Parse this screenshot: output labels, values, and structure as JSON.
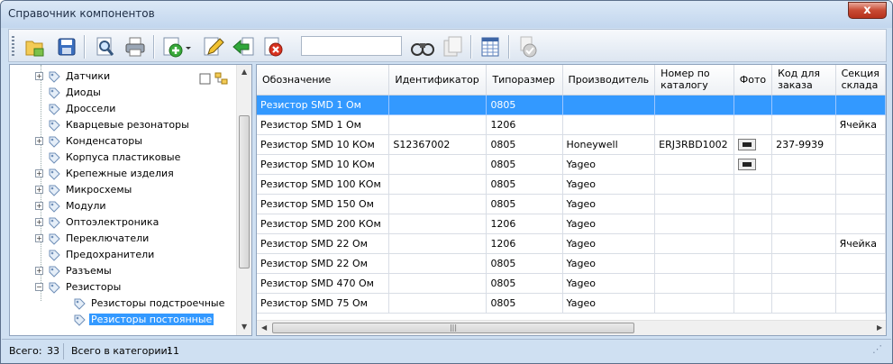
{
  "window": {
    "title": "Справочник компонентов",
    "close_label": "x"
  },
  "toolbar": {
    "buttons": [
      "open-folder",
      "save",
      "preview",
      "print",
      "add",
      "edit",
      "import",
      "delete",
      "find",
      "copy",
      "table",
      "approve"
    ],
    "search_value": ""
  },
  "tree": {
    "items": [
      {
        "label": "Датчики",
        "expander": "+"
      },
      {
        "label": "Диоды",
        "expander": ""
      },
      {
        "label": "Дроссели",
        "expander": ""
      },
      {
        "label": "Кварцевые резонаторы",
        "expander": ""
      },
      {
        "label": "Конденсаторы",
        "expander": "+"
      },
      {
        "label": "Корпуса пластиковые",
        "expander": ""
      },
      {
        "label": "Крепежные изделия",
        "expander": "+"
      },
      {
        "label": "Микросхемы",
        "expander": "+"
      },
      {
        "label": "Модули",
        "expander": "+"
      },
      {
        "label": "Оптоэлектроника",
        "expander": "+"
      },
      {
        "label": "Переключатели",
        "expander": "+"
      },
      {
        "label": "Предохранители",
        "expander": ""
      },
      {
        "label": "Разъемы",
        "expander": "+"
      },
      {
        "label": "Резисторы",
        "expander": "−"
      },
      {
        "label": "Резисторы подстроечные",
        "expander": ""
      },
      {
        "label": "Резисторы постоянные",
        "expander": ""
      }
    ],
    "selected_index": 15
  },
  "grid": {
    "columns": [
      "Обозначение",
      "Идентификатор",
      "Типоразмер",
      "Производитель",
      "Номер по каталогу",
      "Фото",
      "Код для заказа",
      "Секция склада"
    ],
    "rows": [
      {
        "name": "Резистор SMD 1 Ом",
        "id": "",
        "size": "0805",
        "maker": "",
        "catalog": "",
        "photo": false,
        "order": "",
        "section": ""
      },
      {
        "name": "Резистор SMD 1 Ом",
        "id": "",
        "size": "1206",
        "maker": "",
        "catalog": "",
        "photo": false,
        "order": "",
        "section": "Ячейка"
      },
      {
        "name": "Резистор SMD 10 КОм",
        "id": "S12367002",
        "size": "0805",
        "maker": "Honeywell",
        "catalog": "ERJ3RBD1002",
        "photo": true,
        "order": "237-9939",
        "section": ""
      },
      {
        "name": "Резистор SMD 10 КОм",
        "id": "",
        "size": "0805",
        "maker": "Yageo",
        "catalog": "",
        "photo": true,
        "order": "",
        "section": ""
      },
      {
        "name": "Резистор SMD 100 КОм",
        "id": "",
        "size": "0805",
        "maker": "Yageo",
        "catalog": "",
        "photo": false,
        "order": "",
        "section": ""
      },
      {
        "name": "Резистор SMD 150 Ом",
        "id": "",
        "size": "0805",
        "maker": "Yageo",
        "catalog": "",
        "photo": false,
        "order": "",
        "section": ""
      },
      {
        "name": "Резистор SMD 200 КОм",
        "id": "",
        "size": "1206",
        "maker": "Yageo",
        "catalog": "",
        "photo": false,
        "order": "",
        "section": ""
      },
      {
        "name": "Резистор SMD 22 Ом",
        "id": "",
        "size": "1206",
        "maker": "Yageo",
        "catalog": "",
        "photo": false,
        "order": "",
        "section": "Ячейка"
      },
      {
        "name": "Резистор SMD 22 Ом",
        "id": "",
        "size": "0805",
        "maker": "Yageo",
        "catalog": "",
        "photo": false,
        "order": "",
        "section": ""
      },
      {
        "name": "Резистор SMD 470 Ом",
        "id": "",
        "size": "0805",
        "maker": "Yageo",
        "catalog": "",
        "photo": false,
        "order": "",
        "section": ""
      },
      {
        "name": "Резистор SMD 75 Ом",
        "id": "",
        "size": "0805",
        "maker": "Yageo",
        "catalog": "",
        "photo": false,
        "order": "",
        "section": ""
      }
    ],
    "selected_index": 0
  },
  "status": {
    "total_label": "Всего:",
    "total_value": "33",
    "category_label": "Всего в категории:",
    "category_value": "11"
  },
  "colors": {
    "selection": "#3399ff",
    "chrome": "#cfe0f2"
  }
}
